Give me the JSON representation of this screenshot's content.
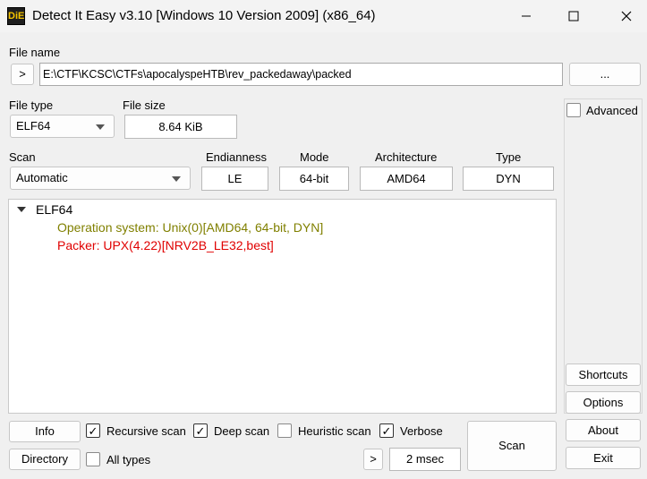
{
  "window": {
    "title": "Detect It Easy v3.10 [Windows 10 Version 2009] (x86_64)",
    "icon_text": "DiE"
  },
  "file": {
    "name_label": "File name",
    "open_label": ">",
    "path": "E:\\CTF\\KCSC\\CTFs\\apocalyspeHTB\\rev_packedaway\\packed",
    "browse_label": "..."
  },
  "file_type": {
    "label": "File type",
    "value": "ELF64"
  },
  "file_size": {
    "label": "File size",
    "value": "8.64 KiB"
  },
  "scan": {
    "label": "Scan",
    "value": "Automatic"
  },
  "info_fields": {
    "endianness": {
      "label": "Endianness",
      "value": "LE"
    },
    "mode": {
      "label": "Mode",
      "value": "64-bit"
    },
    "architecture": {
      "label": "Architecture",
      "value": "AMD64"
    },
    "type": {
      "label": "Type",
      "value": "DYN"
    }
  },
  "results": {
    "root": "ELF64",
    "items": [
      {
        "text": "Operation system: Unix(0)[AMD64, 64-bit, DYN]",
        "color": "#808000"
      },
      {
        "text": "Packer: UPX(4.22)[NRV2B_LE32,best]",
        "color": "#e00000"
      }
    ]
  },
  "options": {
    "advanced": {
      "label": "Advanced",
      "checked": false
    },
    "recursive": {
      "label": "Recursive scan",
      "checked": true
    },
    "deep": {
      "label": "Deep scan",
      "checked": true
    },
    "heuristic": {
      "label": "Heuristic scan",
      "checked": false
    },
    "verbose": {
      "label": "Verbose",
      "checked": true
    },
    "all_types": {
      "label": "All types",
      "checked": false
    }
  },
  "buttons": {
    "info": "Info",
    "directory": "Directory",
    "more": ">",
    "time": "2 msec",
    "scan": "Scan",
    "shortcuts": "Shortcuts",
    "options": "Options",
    "about": "About",
    "exit": "Exit"
  },
  "icons": {
    "check": "✓"
  }
}
